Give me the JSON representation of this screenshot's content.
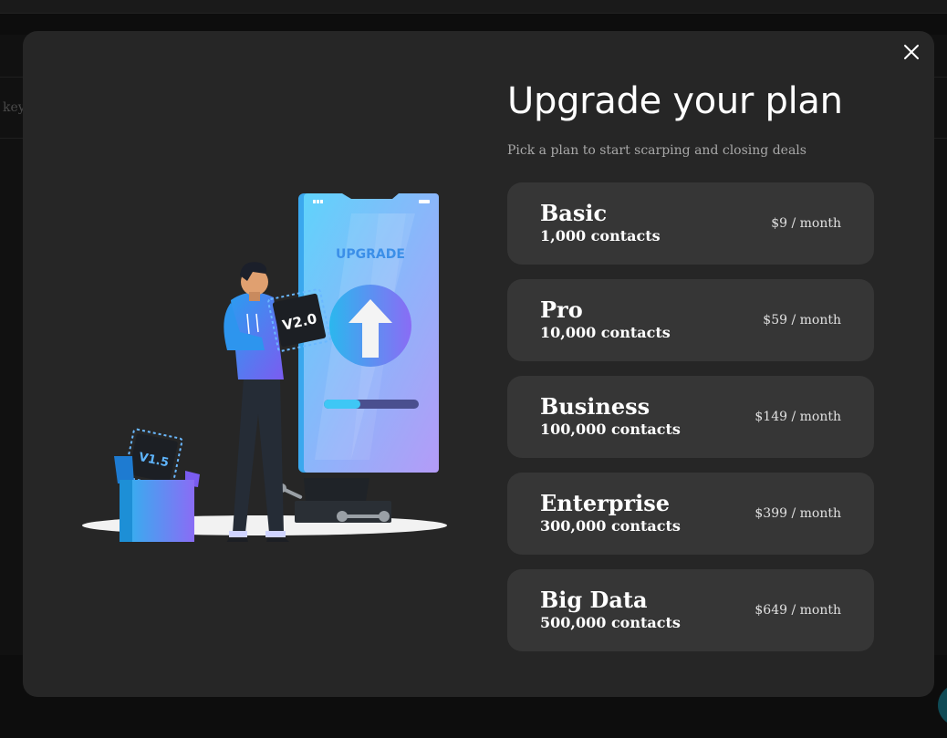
{
  "background": {
    "partial_text": "key"
  },
  "modal": {
    "title": "Upgrade your plan",
    "subtitle": "Pick a plan to start scarping and closing deals",
    "close_icon": "close-icon"
  },
  "illustration": {
    "screen_label": "UPGRADE",
    "chip_new": "V2.0",
    "chip_old": "V1.5"
  },
  "plans": [
    {
      "name": "Basic",
      "contacts": "1,000 contacts",
      "price": "$9 / month"
    },
    {
      "name": "Pro",
      "contacts": "10,000 contacts",
      "price": "$59 / month"
    },
    {
      "name": "Business",
      "contacts": "100,000 contacts",
      "price": "$149 / month"
    },
    {
      "name": "Enterprise",
      "contacts": "300,000 contacts",
      "price": "$399 / month"
    },
    {
      "name": "Big Data",
      "contacts": "500,000 contacts",
      "price": "$649 / month"
    }
  ],
  "colors": {
    "modal_bg": "#262626",
    "card_bg": "#363636",
    "accent_blue": "#3fb6f5",
    "accent_purple": "#a78bfa"
  }
}
